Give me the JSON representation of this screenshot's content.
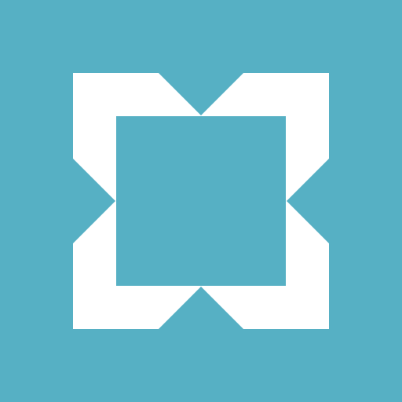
{
  "icon": {
    "name": "app-logo-icon",
    "colors": {
      "background": "#56b0c4",
      "foreground": "#ffffff"
    }
  }
}
